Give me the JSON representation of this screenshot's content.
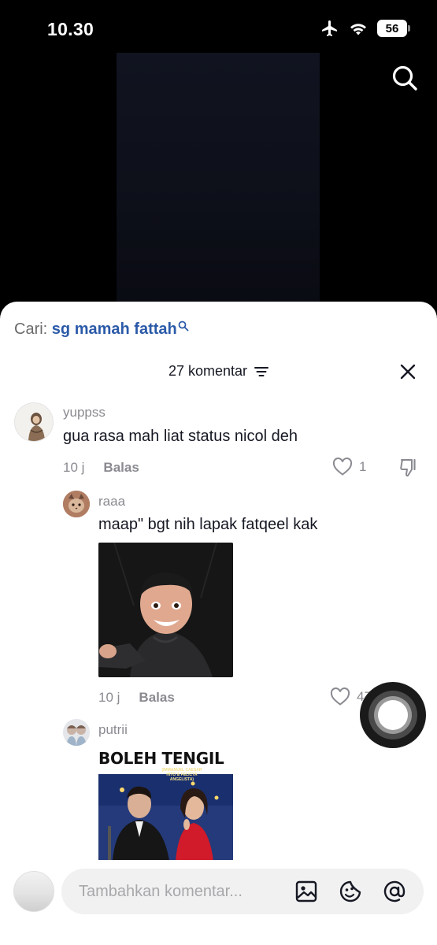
{
  "status_bar": {
    "time": "10.30",
    "battery": "56"
  },
  "search_suggestion": {
    "prefix": "Cari:",
    "term": "sg mamah fattah"
  },
  "comments_header": {
    "count_label": "27 komentar"
  },
  "comments": [
    {
      "username": "yuppss",
      "text": "gua rasa mah liat status nicol deh",
      "time": "10 j",
      "reply_label": "Balas",
      "likes": "1"
    },
    {
      "username": "raaa",
      "text": "maap\" bgt nih lapak fatqeel kak",
      "time": "10 j",
      "reply_label": "Balas",
      "likes": "47"
    },
    {
      "username": "putrii",
      "meme_caption": "BOLEH TENGIL",
      "meme_small_text": "(IMMANUEL CAESAR HITO & FELICYA ANGELISTA)"
    }
  ],
  "input": {
    "placeholder": "Tambahkan komentar..."
  },
  "icons": {
    "airplane": "airplane-mode-icon",
    "wifi": "wifi-icon",
    "search": "search-icon",
    "filter": "filter-icon",
    "close": "close-icon",
    "heart": "heart-icon",
    "dislike": "thumbs-down-icon",
    "image": "image-icon",
    "emoji": "emoji-sticker-icon",
    "mention": "at-mention-icon"
  },
  "colors": {
    "link": "#2b5aa8",
    "muted": "#8a8b91",
    "text": "#161823"
  }
}
